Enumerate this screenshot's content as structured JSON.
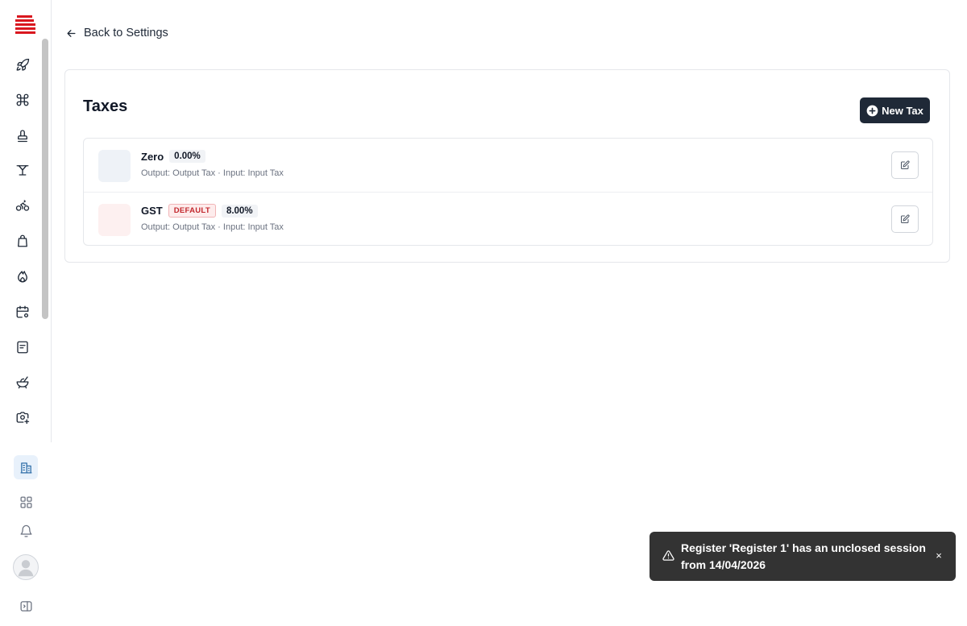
{
  "back_link": {
    "label": "Back to Settings"
  },
  "page": {
    "title": "Taxes",
    "new_button_label": "New Tax"
  },
  "taxes": [
    {
      "name": "Zero",
      "rate": "0.00%",
      "is_default": false,
      "details": "Output: Output Tax · Input: Input Tax",
      "swatch_color": "#eef2f7"
    },
    {
      "name": "GST",
      "rate": "8.00%",
      "is_default": true,
      "default_label": "DEFAULT",
      "details": "Output: Output Tax · Input: Input Tax",
      "swatch_color": "#fdf0f0"
    }
  ],
  "toast": {
    "message": "Register 'Register 1' has an unclosed session from 14/04/2026",
    "close_glyph": "×"
  },
  "sidebar": {
    "logo_color": "#d9171f",
    "nav_icons": [
      "rocket-icon",
      "command-icon",
      "stamp-icon",
      "cocktail-table-icon",
      "bicycle-icon",
      "shopping-bag-icon",
      "flame-icon",
      "calendar-settings-icon",
      "receipt-icon",
      "food-bowl-icon",
      "camera-plus-icon"
    ],
    "bottom_icons": [
      "building-icon",
      "apps-grid-icon",
      "bell-icon",
      "user-avatar",
      "expand-panel-icon"
    ]
  },
  "colors": {
    "accent_dark": "#1f2937",
    "default_badge": "#c2272d",
    "toast_bg": "#333333"
  }
}
